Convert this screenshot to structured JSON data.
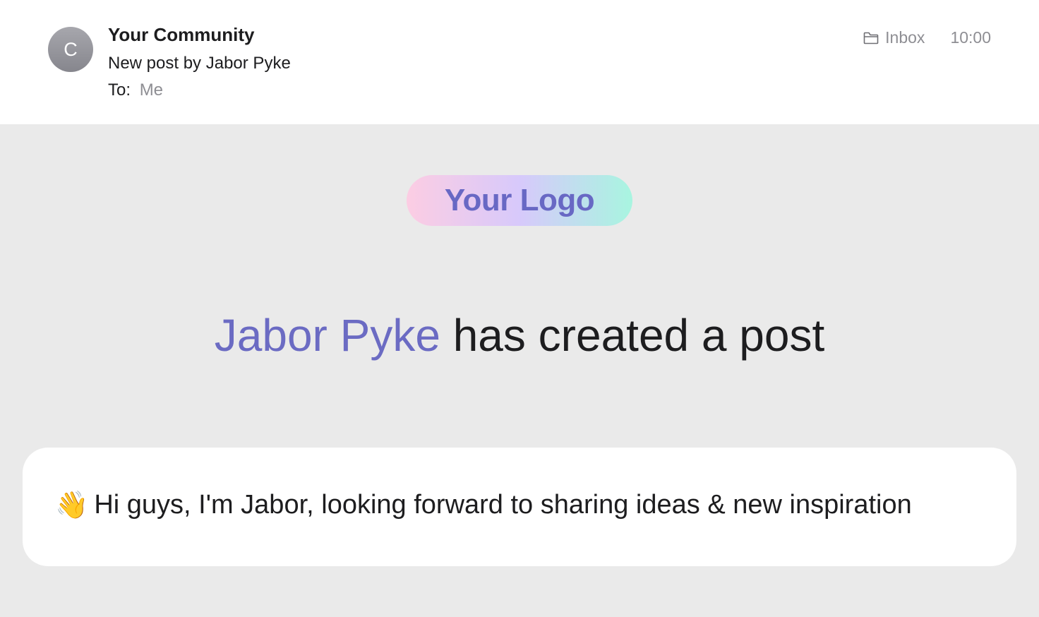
{
  "header": {
    "avatar_initial": "C",
    "sender_name": "Your Community",
    "subject": "New post by Jabor Pyke",
    "to_label": "To:",
    "to_value": "Me",
    "folder_icon": "folder-icon",
    "folder_label": "Inbox",
    "time": "10:00"
  },
  "body": {
    "logo_text": "Your Logo",
    "headline_author": "Jabor Pyke",
    "headline_rest": " has created a post",
    "post_emoji": "👋",
    "post_text": "Hi guys, I'm Jabor, looking forward to sharing ideas & new inspiration"
  },
  "colors": {
    "accent": "#6b6bc3",
    "page_background": "#eaeaea",
    "logo_gradient": [
      "#fccde3",
      "#d7c9fb",
      "#a8f5e0"
    ]
  }
}
